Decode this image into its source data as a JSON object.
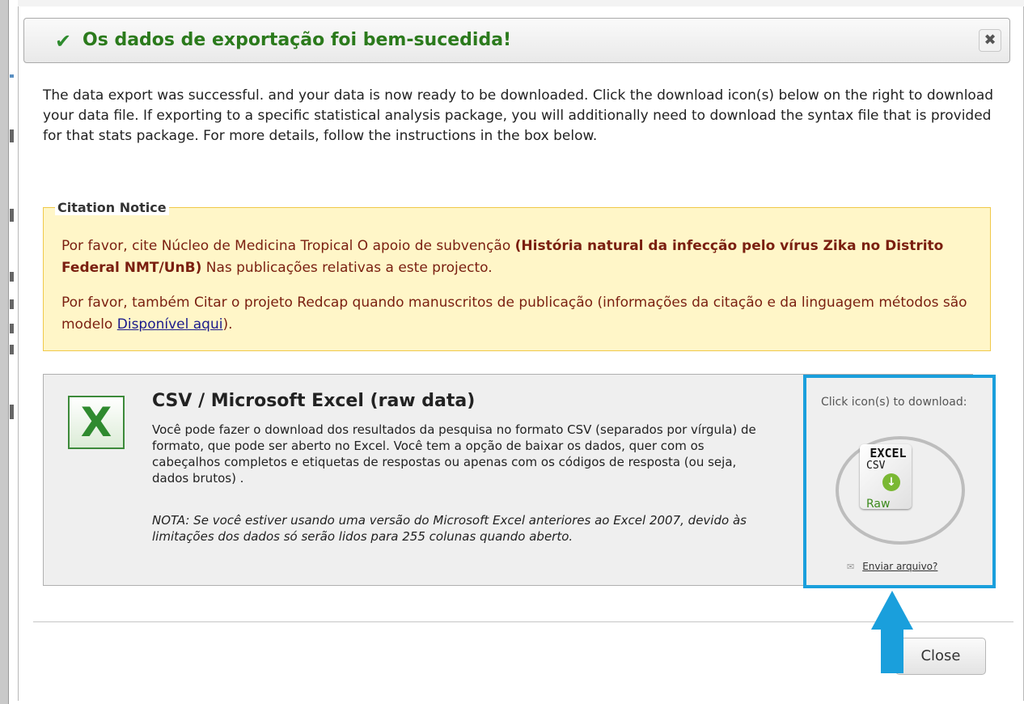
{
  "dialog": {
    "title": "Os dados de exportação foi bem-sucedida!",
    "close_symbol": "✖",
    "intro": "The data export was successful. and your data is now ready to be downloaded. Click the download icon(s) below on the right to download your data file. If exporting to a specific statistical analysis package, you will additionally need to download the syntax file that is provided for that stats package. For more details, follow the instructions in the box below."
  },
  "citation": {
    "legend": "Citation Notice",
    "p1_prefix": "Por favor, cite Núcleo de Medicina Tropical O apoio de subvenção ",
    "p1_bold": "(História natural da infecção pelo vírus Zika no Distrito Federal NMT/UnB)",
    "p1_suffix": " Nas publicações relativas a este projecto.",
    "p2_prefix": "Por favor, também Citar o projeto Redcap quando manuscritos de publicação (informações da citação e da linguagem métodos são modelo ",
    "p2_link": "Disponível aqui",
    "p2_suffix": ")."
  },
  "export": {
    "format_title": "CSV / Microsoft Excel (raw data)",
    "description": "Você pode fazer o download dos resultados da pesquisa no formato CSV (separados por vírgula) de formato, que pode ser aberto no Excel. Você tem a opção de baixar os dados, quer com os cabeçalhos completos e etiquetas de respostas ou apenas com os códigos de resposta (ou seja, dados brutos) .",
    "note": "NOTA: Se você estiver usando uma versão do Microsoft Excel anteriores ao Excel 2007, devido às limitações dos dados só serão lidos para 255 colunas quando aberto."
  },
  "download": {
    "label": "Click icon(s) to download:",
    "icon_excel": "EXCEL",
    "icon_csv": "CSV",
    "icon_raw": "Raw",
    "send_link": "Enviar arquivo?"
  },
  "footer": {
    "close_label": "Close"
  },
  "colors": {
    "title_green": "#2b7a1c",
    "citation_bg": "#fff6c8",
    "citation_text": "#7a1f10",
    "highlight_blue": "#1a9fdc"
  },
  "icons": {
    "title": "check-icon",
    "close": "close-icon",
    "format": "excel-icon",
    "download": "excel-csv-download-icon",
    "send": "envelope-icon",
    "annotation": "up-arrow-icon"
  }
}
